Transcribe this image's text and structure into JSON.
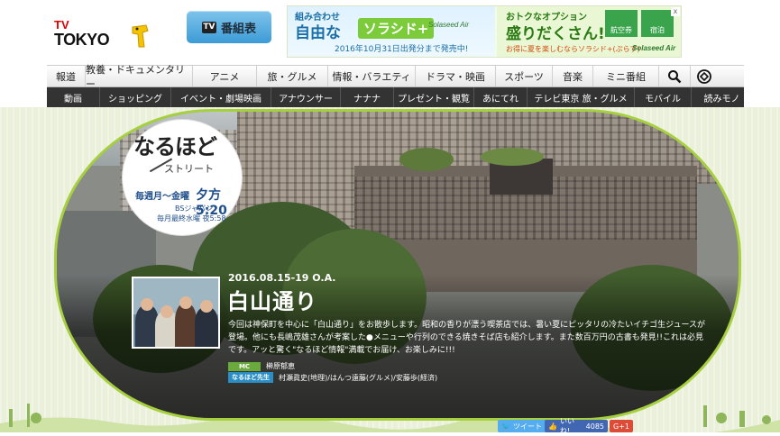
{
  "header": {
    "logo_text": "TV TOKYO",
    "program_button_label": "番組表"
  },
  "banner": {
    "left_line1": "組み合わせ",
    "left_line2": "自由な",
    "left_highlight": "ソラシド+",
    "left_brand": "Solaseed Air",
    "left_footer": "2016年10月31日出発分まで発売中!",
    "right_line1": "おトクなオプション",
    "right_line2": "盛りだくさん!",
    "tile1": "航空券",
    "tile2": "宿泊",
    "right_footer": "お得に夏を楽しむならソラシド+(ぷらす)",
    "right_brand": "Solaseed Air",
    "close_label": "x"
  },
  "nav_primary": [
    "報道",
    "教養・ドキュメンタリー",
    "アニメ",
    "旅・グルメ",
    "情報・バラエティ",
    "ドラマ・映画",
    "スポーツ",
    "音楽",
    "ミニ番組"
  ],
  "nav_secondary": [
    "動画",
    "ショッピング",
    "イベント・劇場映画",
    "アナウンサー",
    "ナナナ",
    "プレゼント・観覧",
    "あにてれ",
    "テレビ東京 旅・グルメ",
    "モバイル",
    "読みモノ"
  ],
  "badge": {
    "title": "なるほど",
    "subtitle": "ストリート",
    "schedule_days": "毎週月〜金曜",
    "schedule_time": "夕方5:20",
    "bs_channel": "BSジャパン",
    "bs_schedule": "毎月最終水曜 夜5:58"
  },
  "episode": {
    "date": "2016.08.15-19 O.A.",
    "title": "白山通り",
    "description": "今回は神保町を中心に「白山通り」をお散歩します。昭和の香りが漂う喫茶店では、暑い夏にピッタリの冷たいイチゴ生ジュースが登場。他にも長嶋茂雄さんが考案した●メニューや行列のできる焼きそば店も紹介します。また数百万円の古書も発見!!これは必見です。アッと驚く\"なるほど情報\"満載でお届け、お楽しみに!!!",
    "mc_label": "MC",
    "mc_name": "榊原郁恵",
    "expert_label": "なるほど先生",
    "experts": "村瀬眞史(地理)/はんつ遠藤(グルメ)/安藤歩(経済)"
  },
  "social": {
    "tweet_label": "ツイート",
    "like_label": "いいね!",
    "like_count": "4085",
    "gplus_label": "G+1"
  },
  "colors": {
    "accent_green": "#a7d03f",
    "nav_dark": "#333333",
    "mc_tag": "#6aa93b",
    "expert_tag": "#2a8ec4"
  }
}
